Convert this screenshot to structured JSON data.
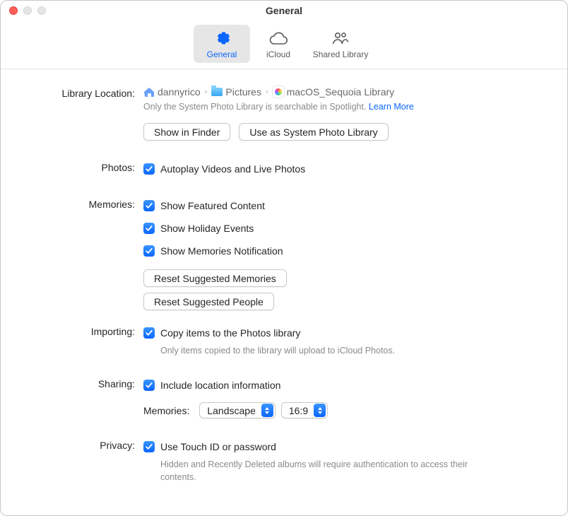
{
  "window": {
    "title": "General"
  },
  "tabs": {
    "general": "General",
    "icloud": "iCloud",
    "shared": "Shared Library"
  },
  "library": {
    "label": "Library Location:",
    "crumb1": "dannyrico",
    "crumb2": "Pictures",
    "crumb3": "macOS_Sequoia Library",
    "hint": "Only the System Photo Library is searchable in Spotlight.",
    "learn_more": "Learn More",
    "show_in_finder": "Show in Finder",
    "use_as_system": "Use as System Photo Library"
  },
  "photos": {
    "label": "Photos:",
    "autoplay": "Autoplay Videos and Live Photos"
  },
  "memories": {
    "label": "Memories:",
    "featured": "Show Featured Content",
    "holiday": "Show Holiday Events",
    "notification": "Show Memories Notification",
    "reset_memories": "Reset Suggested Memories",
    "reset_people": "Reset Suggested People"
  },
  "importing": {
    "label": "Importing:",
    "copy": "Copy items to the Photos library",
    "hint": "Only items copied to the library will upload to iCloud Photos."
  },
  "sharing": {
    "label": "Sharing:",
    "location": "Include location information",
    "memories_label": "Memories:",
    "orientation": "Landscape",
    "aspect": "16:9"
  },
  "privacy": {
    "label": "Privacy:",
    "touchid": "Use Touch ID or password",
    "hint": "Hidden and Recently Deleted albums will require authentication to access their contents."
  }
}
